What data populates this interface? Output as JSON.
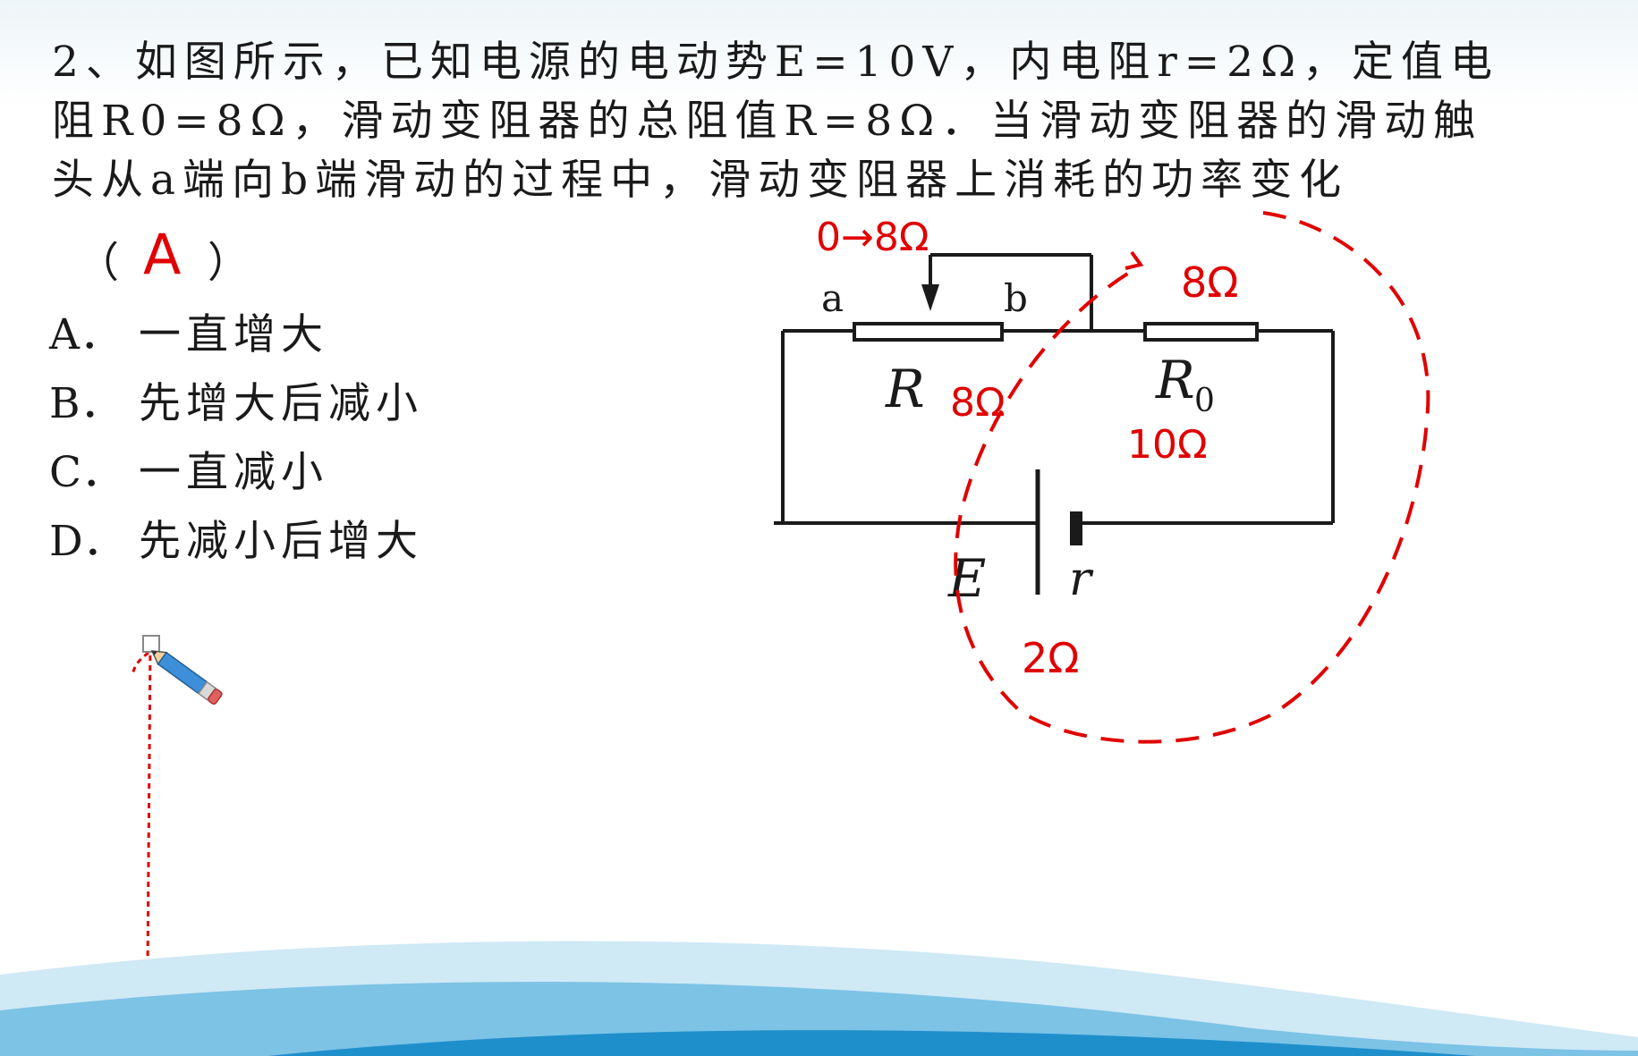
{
  "question": {
    "lines": [
      "2、如图所示，已知电源的电动势E=10V，内电阻r=2Ω，定值电",
      "阻R0=8Ω，滑动变阻器的总阻值R=8Ω．当滑动变阻器的滑动触",
      "头从a端向b端滑动的过程中，滑动变阻器上消耗的功率变化"
    ],
    "paren_open": "（",
    "answer": "A",
    "paren_close": "）"
  },
  "options": [
    {
      "label": "A．",
      "text": "一直增大"
    },
    {
      "label": "B．",
      "text": "先增大后减小"
    },
    {
      "label": "C．",
      "text": "一直减小"
    },
    {
      "label": "D．",
      "text": "先减小后增大"
    }
  ],
  "circuit": {
    "node_a": "a",
    "node_b": "b",
    "rheostat": "R",
    "fixed_resistor": "R",
    "fixed_resistor_sub": "0",
    "source_emf": "E",
    "internal_r": "r"
  },
  "annotations": {
    "slider_range": "0→8Ω",
    "r0_top": "8Ω",
    "rheostat_value": "8Ω",
    "r0_equiv": "10Ω",
    "internal_value": "2Ω"
  },
  "colors": {
    "annotation": "#e00000",
    "text": "#1a1a1a",
    "wave_dark": "#1f8fcc",
    "wave_light": "#cfe9f5"
  }
}
